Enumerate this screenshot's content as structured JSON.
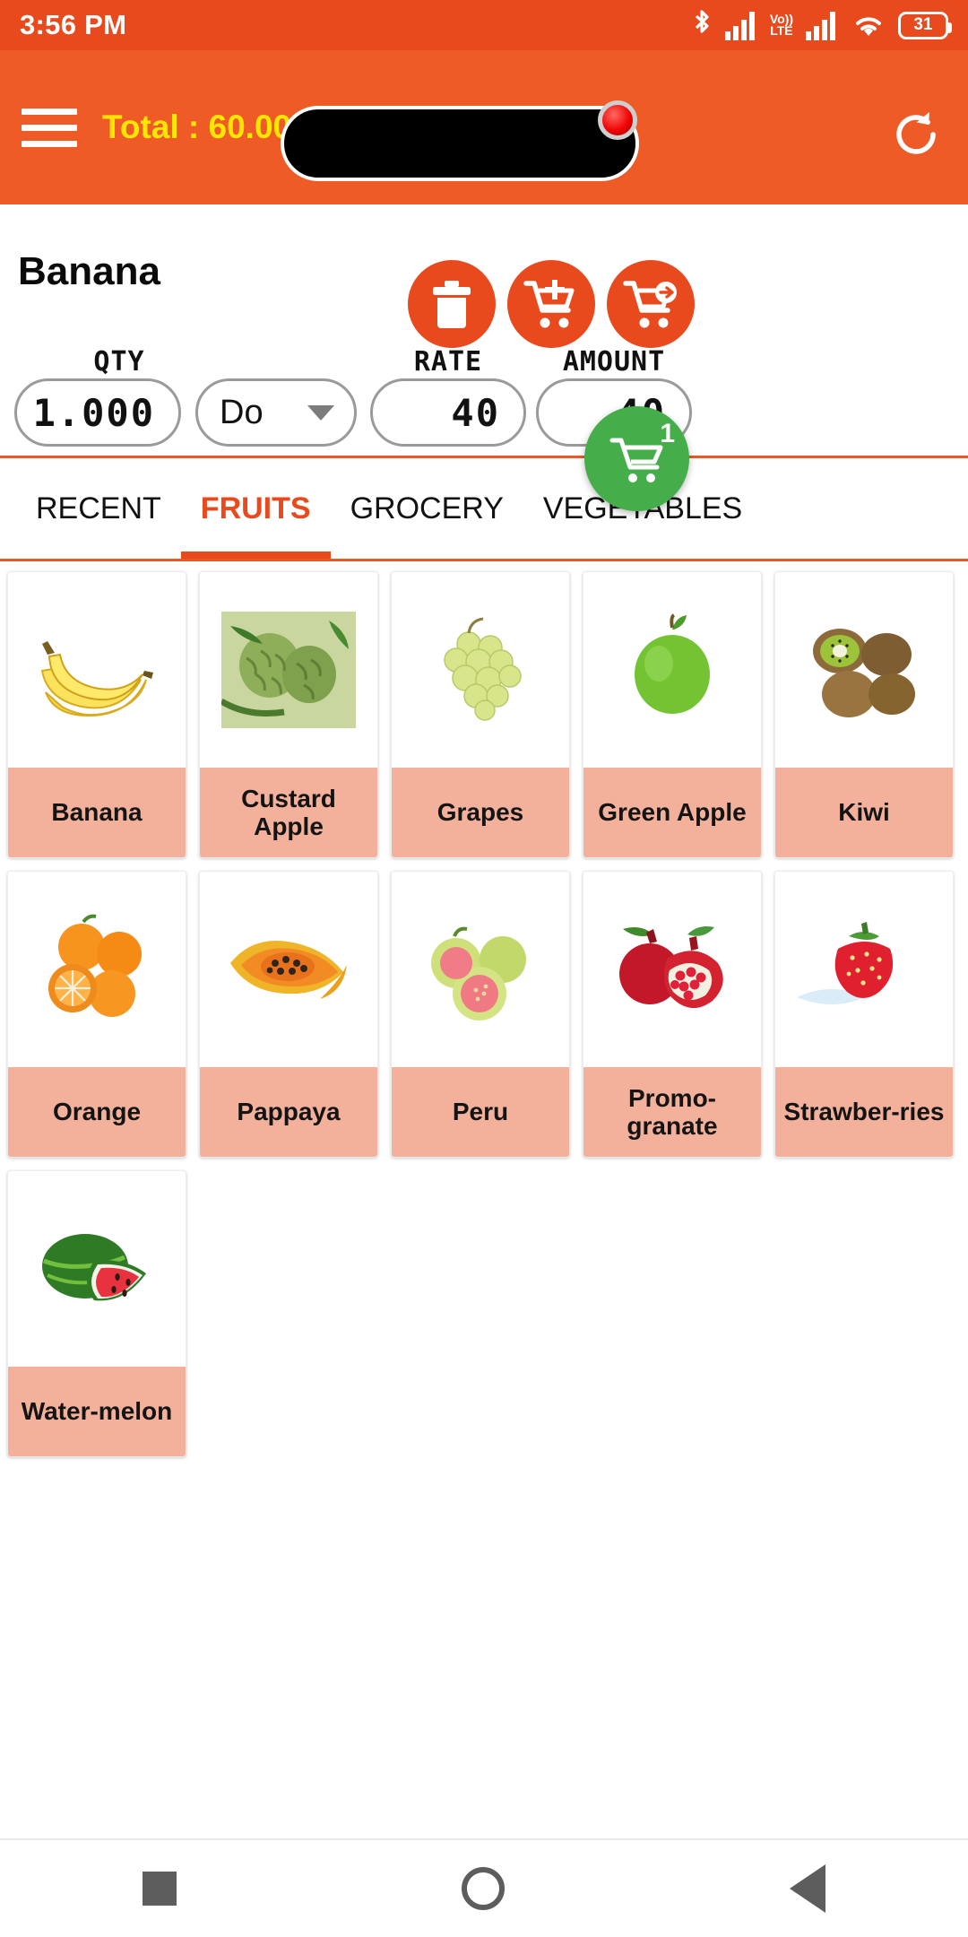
{
  "status_bar": {
    "time": "3:56 PM",
    "battery_level": "31",
    "volte_label_top": "Vo))",
    "volte_label_bottom": "LTE",
    "icons": [
      "bluetooth-icon",
      "signal-icon",
      "volte-icon",
      "signal-icon-2",
      "wifi-icon",
      "battery-icon"
    ]
  },
  "app_bar": {
    "menu_icon": "hamburger-menu-icon",
    "total_label": "Total : ",
    "total_value": "60.00",
    "weight_display_value": "",
    "indicator": "red-led-indicator",
    "refresh_icon": "refresh-icon",
    "background_color": "#ef5b26",
    "total_color": "#ffe600"
  },
  "product_header": {
    "name": "Banana",
    "search_icon": "search-icon",
    "actions": [
      {
        "name": "delete-button",
        "icon": "trash-icon"
      },
      {
        "name": "add-to-cart-button",
        "icon": "cart-plus-icon"
      },
      {
        "name": "checkout-button",
        "icon": "cart-arrow-icon"
      }
    ],
    "action_color": "#e8491d"
  },
  "meters": {
    "qty": {
      "label": "QTY",
      "value": "1.000"
    },
    "unit": {
      "value": "Do",
      "caret": "chevron-down-icon"
    },
    "rate": {
      "label": "RATE",
      "value": "40"
    },
    "amount": {
      "label": "AMOUNT",
      "value": "40"
    }
  },
  "tabs": {
    "active_color": "#e8491d",
    "items": [
      {
        "label": "RECENT",
        "active": false
      },
      {
        "label": "FRUITS",
        "active": true
      },
      {
        "label": "GROCERY",
        "active": false
      },
      {
        "label": "VEGETABLES",
        "active": false
      }
    ]
  },
  "cart_fab": {
    "icon": "shopping-cart-icon",
    "badge_count": "1",
    "color": "#45ae4a"
  },
  "products": [
    {
      "name": "Banana",
      "image": "banana-image"
    },
    {
      "name": "Custard Apple",
      "image": "custard-apple-image"
    },
    {
      "name": "Grapes",
      "image": "grapes-image"
    },
    {
      "name": "Green Apple",
      "image": "green-apple-image"
    },
    {
      "name": "Kiwi",
      "image": "kiwi-image"
    },
    {
      "name": "Orange",
      "image": "orange-image"
    },
    {
      "name": "Pappaya",
      "image": "papaya-image"
    },
    {
      "name": "Peru",
      "image": "guava-image"
    },
    {
      "name": "Promo-granate",
      "image": "pomegranate-image"
    },
    {
      "name": "Strawber-ries",
      "image": "strawberry-image"
    },
    {
      "name": "Water-melon",
      "image": "watermelon-image"
    }
  ],
  "nav_bar": {
    "recents": "square-icon",
    "home": "circle-icon",
    "back": "triangle-back-icon"
  }
}
